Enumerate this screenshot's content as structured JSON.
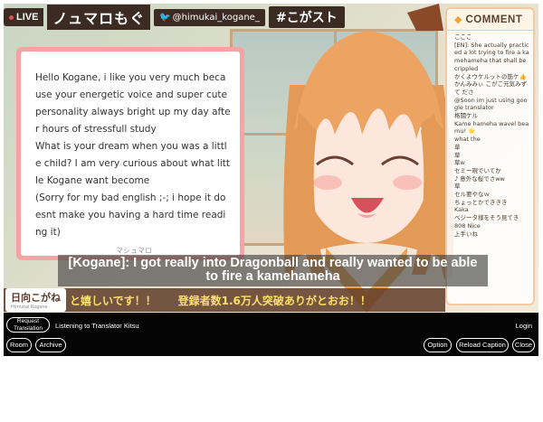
{
  "stream": {
    "live_label": "LIVE",
    "channel_title": "ノュマロもぐ",
    "twitter_handle": "@himukai_kogane_",
    "hashtag": "#こがスト"
  },
  "letter": {
    "paragraphs": [
      "Hello Kogane, i like you very much because your energetic voice and super cute personality always bright up my day after hours of stressfull study",
      "What is your dream when you was a little child? I am very curious about what little Kogane want become",
      "(Sorry for my bad english ;-; i hope it doesnt make you having a hard time reading it)"
    ],
    "watermark": "マシュマロ"
  },
  "comments": {
    "title": "COMMENT",
    "items": [
      "こここ",
      "[EN]: She actually practiced a lot trying to fire a kamehameha that shall be crippled",
      "かくよウケルットの筋ケ👍",
      "かんみみぃ こがこ元気みずて ださ",
      "@Soon im just using google translator",
      "格闘ケル",
      "Kame hameha wavel beamu! 🌟",
      "what the",
      "草",
      "草",
      "草w",
      "セミー現でいてか",
      "♪ 意外な桜でさww",
      "草",
      "セル要やなｗ",
      "ちょっとかでききき",
      "Kaka",
      "ベジータ様をそう見てき",
      "808 Nice",
      "上手いね"
    ]
  },
  "subtitle": {
    "text": "[Kogane]: I got really into Dragonball and really wanted to be able to fire a kamehameha"
  },
  "ticker": {
    "name_logo": "日向こがね",
    "name_logo_sub": "Himukai Kogane",
    "text": "と嬉しいです！！　　登録者数1.6万人突破ありがとおお！！"
  },
  "controls": {
    "request_translation": "Request Translation",
    "listening_status": "Listening to Translator Kitsu",
    "login": "Login",
    "room": "Room",
    "archive": "Archive",
    "option": "Option",
    "reload_caption": "Reload Caption",
    "close": "Close"
  },
  "colors": {
    "letter_border": "#f7a3a3",
    "ticker_bg": "#5f3c28",
    "ticker_text": "#fbdf6b",
    "hair": "#e39a56",
    "control_bar": "#050505"
  }
}
